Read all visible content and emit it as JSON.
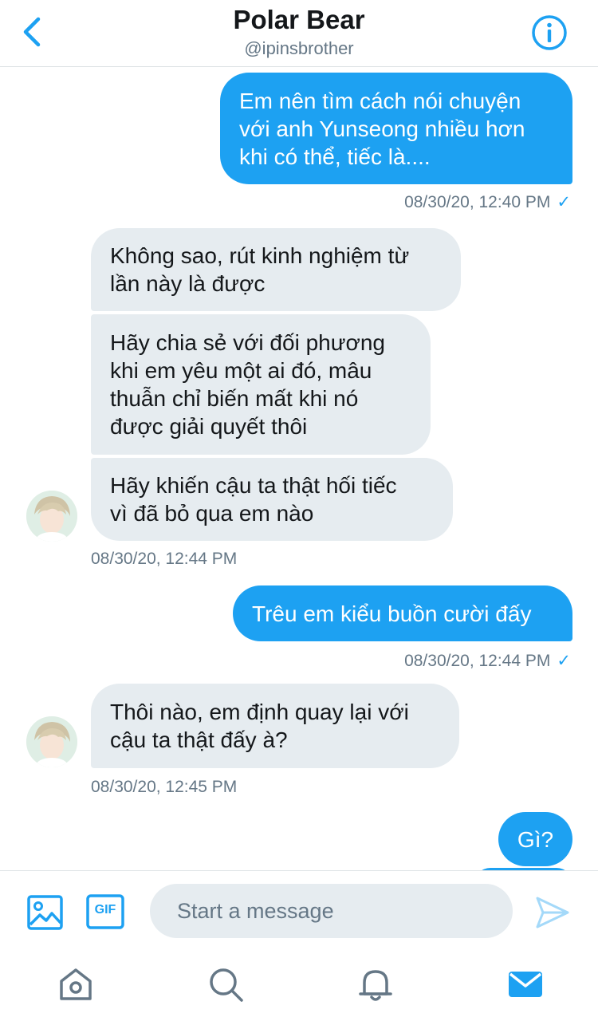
{
  "header": {
    "title": "Polar Bear",
    "handle": "@ipinsbrother"
  },
  "messages": [
    {
      "direction": "outgoing",
      "text": "Em nên tìm cách nói chuyện với anh Yunseong nhiều hơn khi có thể, tiếc là....",
      "lines": [
        "Em nên tìm cách nói chuyện",
        "với anh Yunseong nhiều hơn",
        "khi có thể, tiếc là...."
      ]
    },
    {
      "direction": "outgoing_timestamp",
      "text": "08/30/20, 12:40 PM",
      "check": "✓"
    },
    {
      "direction": "incoming",
      "lines": [
        "Không sao, rút kinh nghiệm từ",
        "lần này là được"
      ]
    },
    {
      "direction": "incoming",
      "lines": [
        "Hãy chia sẻ với đối phương",
        "khi em yêu một ai đó, mâu",
        "thuẫn chỉ biến mất khi nó",
        "được giải quyết thôi"
      ]
    },
    {
      "direction": "incoming",
      "lines": [
        "Hãy khiến cậu ta thật hối tiếc",
        "vì đã bỏ qua em nào"
      ]
    },
    {
      "direction": "incoming_timestamp",
      "text": "08/30/20, 12:44 PM"
    },
    {
      "direction": "outgoing",
      "lines": [
        "Trêu em kiểu buồn cười đấy"
      ]
    },
    {
      "direction": "outgoing_timestamp",
      "text": "08/30/20, 12:44 PM",
      "check": "✓"
    },
    {
      "direction": "incoming",
      "lines": [
        "Thôi nào, em định quay lại với",
        "cậu ta thật đấy à?"
      ]
    },
    {
      "direction": "incoming_timestamp",
      "text": "08/30/20, 12:45 PM"
    },
    {
      "direction": "outgoing",
      "lines": [
        "Gì?"
      ]
    }
  ],
  "composer": {
    "placeholder": "Start a message",
    "gif_label": "GIF",
    "icons": [
      "image-icon",
      "gif-icon",
      "send-icon"
    ]
  },
  "tabbar": {
    "items": [
      "home-icon",
      "search-icon",
      "notifications-icon",
      "messages-icon"
    ],
    "active": "messages-icon"
  },
  "colors": {
    "accent": "#1da1f2",
    "incoming_bubble": "#e6ecf0",
    "secondary_text": "#657786"
  }
}
